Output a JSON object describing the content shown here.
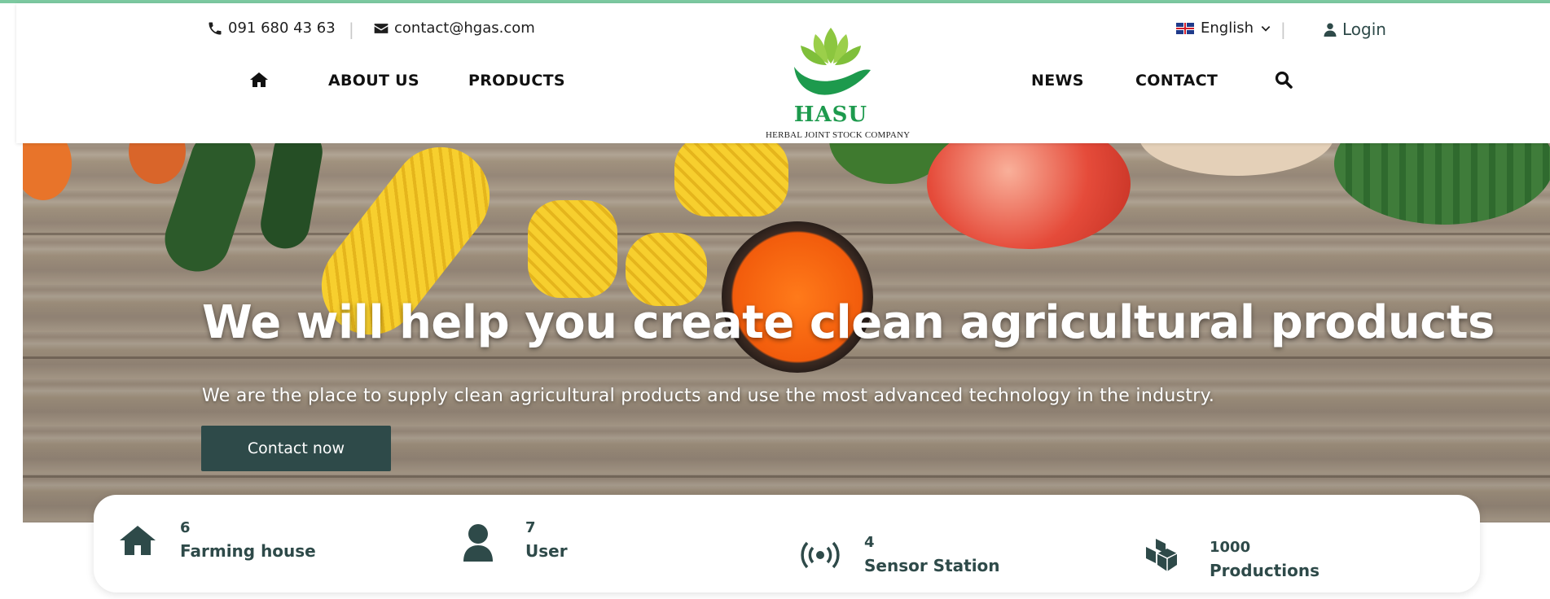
{
  "header": {
    "phone": "091 680 43 63",
    "email": "contact@hgas.com",
    "language": "English",
    "login_label": "Login",
    "logo_name": "HASU",
    "logo_subtitle": "HERBAL JOINT STOCK COMPANY",
    "separator": "|"
  },
  "nav": {
    "home_icon": "home-icon",
    "about": "ABOUT US",
    "products": "PRODUCTS",
    "news": "NEWS",
    "contact": "CONTACT",
    "search_icon": "search-icon"
  },
  "hero": {
    "title": "We will help you create clean agricultural products",
    "subtitle": "We are the place to supply clean agricultural products and use the most advanced technology in the industry.",
    "cta": "Contact now"
  },
  "stats": [
    {
      "icon": "home-icon",
      "value": "6",
      "label": "Farming house"
    },
    {
      "icon": "user-icon",
      "value": "7",
      "label": "User"
    },
    {
      "icon": "broadcast-icon",
      "value": "4",
      "label": "Sensor Station"
    },
    {
      "icon": "cubes-icon",
      "value": "1000",
      "label": "Productions"
    }
  ],
  "colors": {
    "accent": "#2e4a49",
    "brand_green": "#1d9a4d",
    "top_line": "#7cc9a0"
  }
}
